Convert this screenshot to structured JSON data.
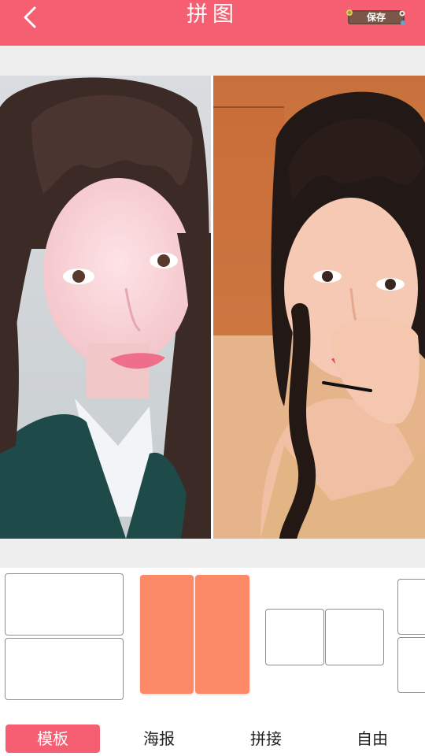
{
  "header": {
    "title": "拼图",
    "back_icon": "chevron-left-icon",
    "save_label": "保存"
  },
  "collage": {
    "layout": "two-columns",
    "photos": [
      {
        "name": "photo-left"
      },
      {
        "name": "photo-right"
      }
    ]
  },
  "templates": {
    "selected_index": 1,
    "items": [
      {
        "name": "two-rows"
      },
      {
        "name": "two-columns"
      },
      {
        "name": "two-squares"
      },
      {
        "name": "two-rows-partial"
      }
    ]
  },
  "tabs": {
    "active_index": 0,
    "items": [
      {
        "label": "模板"
      },
      {
        "label": "海报"
      },
      {
        "label": "拼接"
      },
      {
        "label": "自由"
      }
    ]
  },
  "colors": {
    "accent": "#f65f72",
    "selected_template": "#fc8a68",
    "band": "#eeeeee"
  }
}
